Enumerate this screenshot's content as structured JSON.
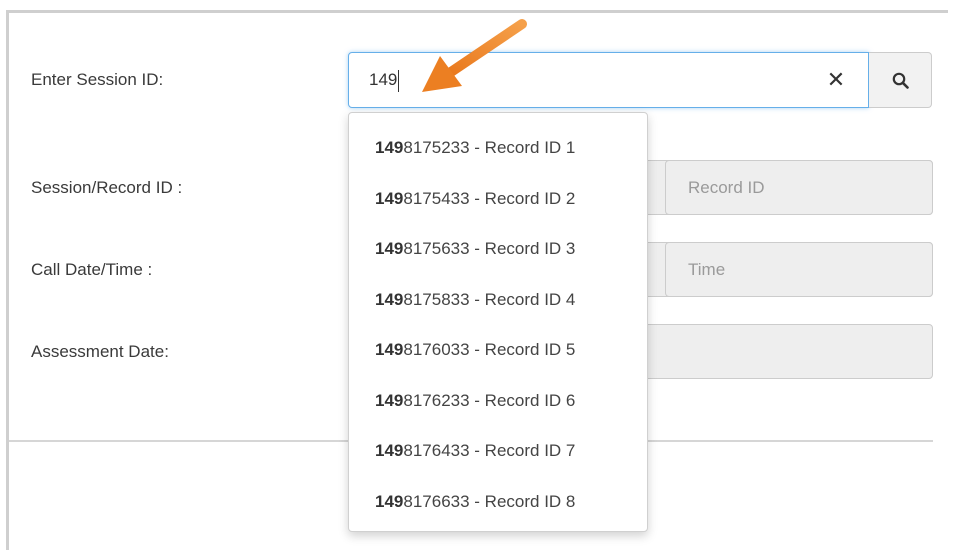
{
  "form": {
    "session_label": "Enter Session ID:",
    "session_record_label": "Session/Record ID :",
    "call_datetime_label": "Call Date/Time :",
    "assessment_label": "Assessment Date:"
  },
  "search": {
    "value": "149",
    "clear_symbol": "✕"
  },
  "fields": {
    "record_id_placeholder": "Record ID",
    "time_placeholder": "Time"
  },
  "dropdown": {
    "match": "149",
    "items": [
      {
        "bold": "149",
        "rest": "8175233 - Record ID 1"
      },
      {
        "bold": "149",
        "rest": "8175433 - Record ID 2"
      },
      {
        "bold": "149",
        "rest": "8175633 - Record ID 3"
      },
      {
        "bold": "149",
        "rest": "8175833 - Record ID 4"
      },
      {
        "bold": "149",
        "rest": "8176033 - Record ID 5"
      },
      {
        "bold": "149",
        "rest": "8176233 - Record ID 6"
      },
      {
        "bold": "149",
        "rest": "8176433 - Record ID 7"
      },
      {
        "bold": "149",
        "rest": "8176633 - Record ID 8"
      }
    ]
  },
  "colors": {
    "focus_border": "#66afe9",
    "arrow": "#f08a2c",
    "readonly_bg": "#eeeeee"
  },
  "icons": {
    "search": "search-icon",
    "clear": "close-icon",
    "annotation": "arrow-annotation"
  }
}
